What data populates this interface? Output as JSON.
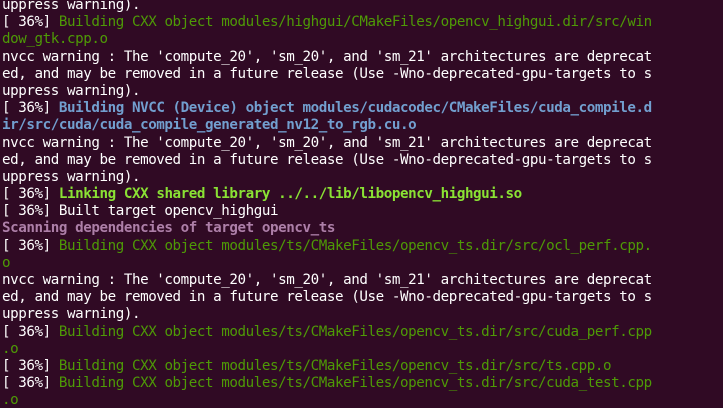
{
  "colors": {
    "background": "#300a24",
    "default": "#ffffff",
    "green": "#4e9a06",
    "blue": "#729fcf",
    "bold_green": "#8ae234",
    "magenta": "#ad7fa8"
  },
  "terminal": {
    "lines": [
      {
        "segs": [
          {
            "t": "uppress warning).",
            "c": "default"
          }
        ]
      },
      {
        "segs": [
          {
            "t": "[ 36%] ",
            "c": "default"
          },
          {
            "t": "Building CXX object modules/highgui/CMakeFiles/opencv_highgui.dir/src/win",
            "c": "green"
          }
        ]
      },
      {
        "segs": [
          {
            "t": "dow_gtk.cpp.o",
            "c": "green"
          }
        ]
      },
      {
        "segs": [
          {
            "t": "nvcc warning : The 'compute_20', 'sm_20', and 'sm_21' architectures are deprecat",
            "c": "default"
          }
        ]
      },
      {
        "segs": [
          {
            "t": "ed, and may be removed in a future release (Use -Wno-deprecated-gpu-targets to s",
            "c": "default"
          }
        ]
      },
      {
        "segs": [
          {
            "t": "uppress warning).",
            "c": "default"
          }
        ]
      },
      {
        "segs": [
          {
            "t": "[ 36%] ",
            "c": "default"
          },
          {
            "t": "Building NVCC (Device) object modules/cudacodec/CMakeFiles/cuda_compile.d",
            "c": "blue",
            "b": true
          }
        ]
      },
      {
        "segs": [
          {
            "t": "ir/src/cuda/cuda_compile_generated_nv12_to_rgb.cu.o",
            "c": "blue",
            "b": true
          }
        ]
      },
      {
        "segs": [
          {
            "t": "nvcc warning : The 'compute_20', 'sm_20', and 'sm_21' architectures are deprecat",
            "c": "default"
          }
        ]
      },
      {
        "segs": [
          {
            "t": "ed, and may be removed in a future release (Use -Wno-deprecated-gpu-targets to s",
            "c": "default"
          }
        ]
      },
      {
        "segs": [
          {
            "t": "uppress warning).",
            "c": "default"
          }
        ]
      },
      {
        "segs": [
          {
            "t": "[ 36%] ",
            "c": "default"
          },
          {
            "t": "Linking CXX shared library ../../lib/libopencv_highgui.so",
            "c": "bold_green",
            "b": true
          }
        ]
      },
      {
        "segs": [
          {
            "t": "[ 36%] Built target opencv_highgui",
            "c": "default"
          }
        ]
      },
      {
        "segs": [
          {
            "t": "Scanning dependencies of target opencv_ts",
            "c": "magenta",
            "b": true
          }
        ]
      },
      {
        "segs": [
          {
            "t": "[ 36%] ",
            "c": "default"
          },
          {
            "t": "Building CXX object modules/ts/CMakeFiles/opencv_ts.dir/src/ocl_perf.cpp.",
            "c": "green"
          }
        ]
      },
      {
        "segs": [
          {
            "t": "o",
            "c": "green"
          }
        ]
      },
      {
        "segs": [
          {
            "t": "nvcc warning : The 'compute_20', 'sm_20', and 'sm_21' architectures are deprecat",
            "c": "default"
          }
        ]
      },
      {
        "segs": [
          {
            "t": "ed, and may be removed in a future release (Use -Wno-deprecated-gpu-targets to s",
            "c": "default"
          }
        ]
      },
      {
        "segs": [
          {
            "t": "uppress warning).",
            "c": "default"
          }
        ]
      },
      {
        "segs": [
          {
            "t": "[ 36%] ",
            "c": "default"
          },
          {
            "t": "Building CXX object modules/ts/CMakeFiles/opencv_ts.dir/src/cuda_perf.cpp",
            "c": "green"
          }
        ]
      },
      {
        "segs": [
          {
            "t": ".o",
            "c": "green"
          }
        ]
      },
      {
        "segs": [
          {
            "t": "[ 36%] ",
            "c": "default"
          },
          {
            "t": "Building CXX object modules/ts/CMakeFiles/opencv_ts.dir/src/ts.cpp.o",
            "c": "green"
          }
        ]
      },
      {
        "segs": [
          {
            "t": "[ 36%] ",
            "c": "default"
          },
          {
            "t": "Building CXX object modules/ts/CMakeFiles/opencv_ts.dir/src/cuda_test.cpp",
            "c": "green"
          }
        ]
      },
      {
        "segs": [
          {
            "t": ".o",
            "c": "green"
          }
        ]
      }
    ]
  }
}
